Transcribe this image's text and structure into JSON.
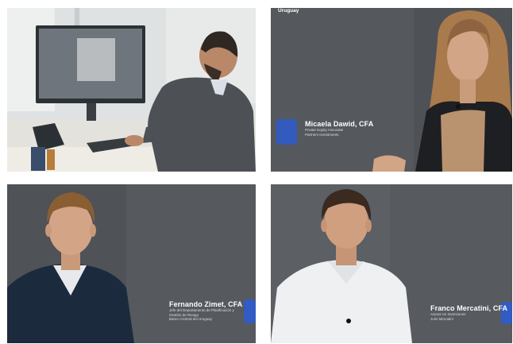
{
  "panels": [
    {
      "id": "p1"
    },
    {
      "id": "p2",
      "logo_text": "Uruguay",
      "caption": {
        "name": "Micaela Dawid, CFA",
        "lines": [
          "Private Equity Associate",
          "Partners Investments"
        ]
      }
    },
    {
      "id": "p3",
      "caption": {
        "name": "Fernando Zimet, CFA",
        "lines": [
          "Jefe del Departamento de Planificación y",
          "Gestión de Riesgo",
          "Banco Central del Uruguay"
        ]
      }
    },
    {
      "id": "p4",
      "caption": {
        "name": "Franco Mercatini, CFA",
        "lines": [
          "Asesor en Inversiones",
          "Julio Mercatini"
        ]
      }
    }
  ],
  "colors": {
    "accent_blue": "#2b5cd6"
  }
}
